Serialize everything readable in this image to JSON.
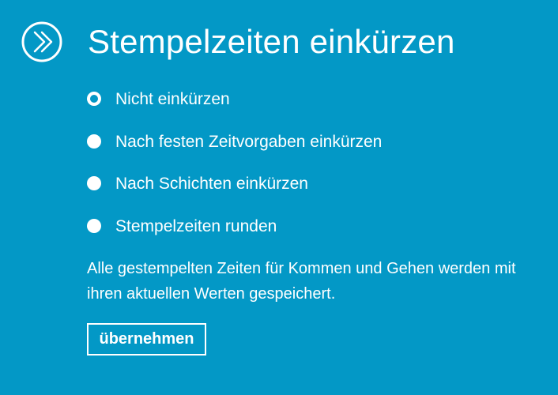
{
  "header": {
    "icon": "double-chevron-right-circle-icon",
    "title": "Stempelzeiten einkürzen"
  },
  "options": [
    {
      "label": "Nicht einkürzen",
      "selected": true
    },
    {
      "label": "Nach festen Zeitvorgaben einkürzen",
      "selected": false
    },
    {
      "label": "Nach Schichten einkürzen",
      "selected": false
    },
    {
      "label": "Stempelzeiten runden",
      "selected": false
    }
  ],
  "description": "Alle gestempelten Zeiten für Kommen und Gehen werden mit ihren aktuellen Werten gespeichert.",
  "button": {
    "label": "übernehmen"
  },
  "colors": {
    "background": "#0398c6",
    "foreground": "#ffffff"
  }
}
